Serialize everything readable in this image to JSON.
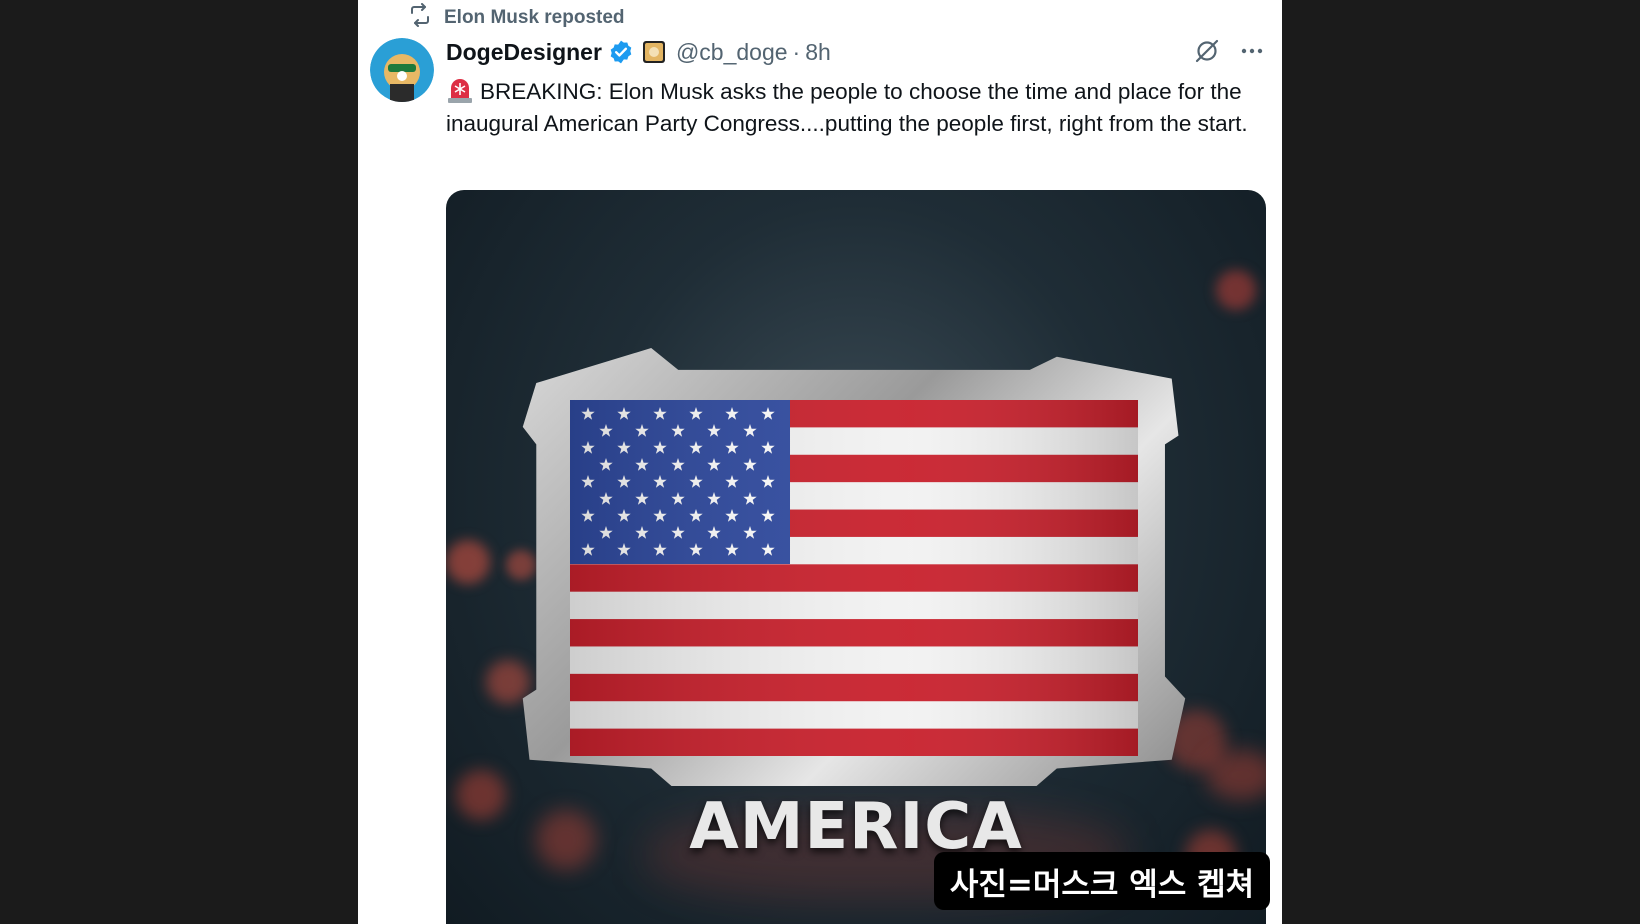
{
  "repost": {
    "text": "Elon Musk reposted",
    "icon": "repost-icon"
  },
  "author": {
    "display_name": "DogeDesigner",
    "handle": "@cb_doge",
    "time": "8h",
    "separator": "·",
    "verified_color": "#1d9bf0"
  },
  "tweet": {
    "emoji": "rotating-light-emoji",
    "text": "BREAKING: Elon Musk asks the people to choose the time and place for the inaugural American Party Congress....putting the people first, right from the start."
  },
  "media": {
    "title": "AMERICA",
    "flag_colors": {
      "red": "#c8202c",
      "white": "#f2f2f2",
      "blue": "#2f4aa0"
    }
  },
  "caption": {
    "text": "사진=머스크 엑스 켑쳐"
  },
  "colors": {
    "secondary_text": "#536471",
    "primary_text": "#0f1419"
  }
}
